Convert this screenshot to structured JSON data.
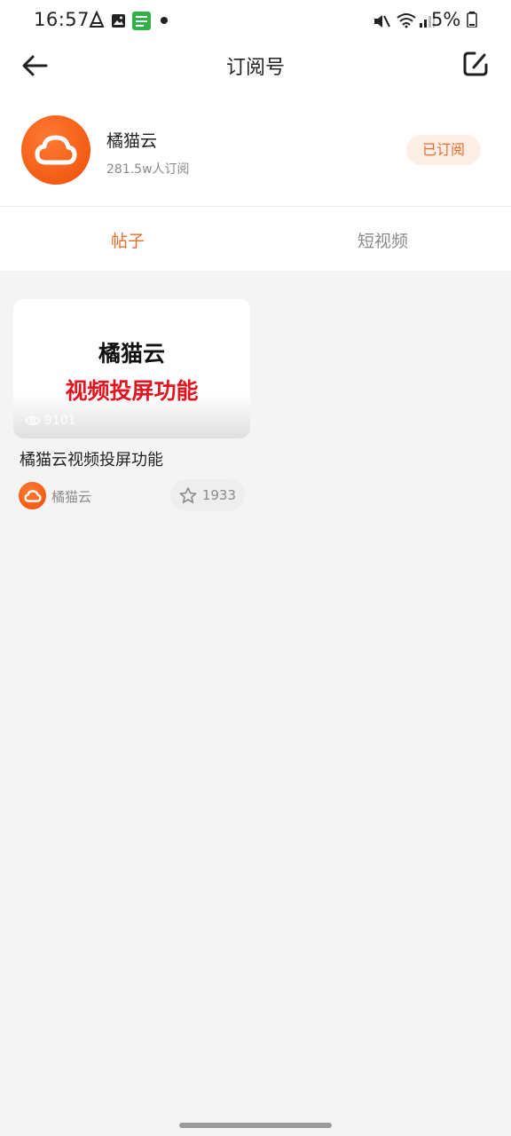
{
  "status_bar": {
    "time": "16:57",
    "battery": "5%",
    "icons": [
      "mute-icon",
      "wifi-icon",
      "signal-icon",
      "battery-icon",
      "photo-icon",
      "app-notify-icon"
    ]
  },
  "header": {
    "title": "订阅号",
    "back_icon": "back-arrow-icon",
    "edit_icon": "edit-icon"
  },
  "channel": {
    "name": "橘猫云",
    "subscribers": "281.5w人订阅",
    "subscribe_label": "已订阅"
  },
  "tabs": [
    {
      "label": "帖子",
      "active": true
    },
    {
      "label": "短视频",
      "active": false
    }
  ],
  "posts": [
    {
      "thumb_line1": "橘猫云",
      "thumb_line2": "视频投屏功能",
      "views": "9101",
      "title": "橘猫云视频投屏功能",
      "author": "橘猫云",
      "likes": "1933"
    }
  ],
  "colors": {
    "accent": "#f06a2a",
    "accent_bg": "#fdeee6",
    "thumb_red": "#e5141e",
    "page_bg": "#f4f4f4"
  }
}
